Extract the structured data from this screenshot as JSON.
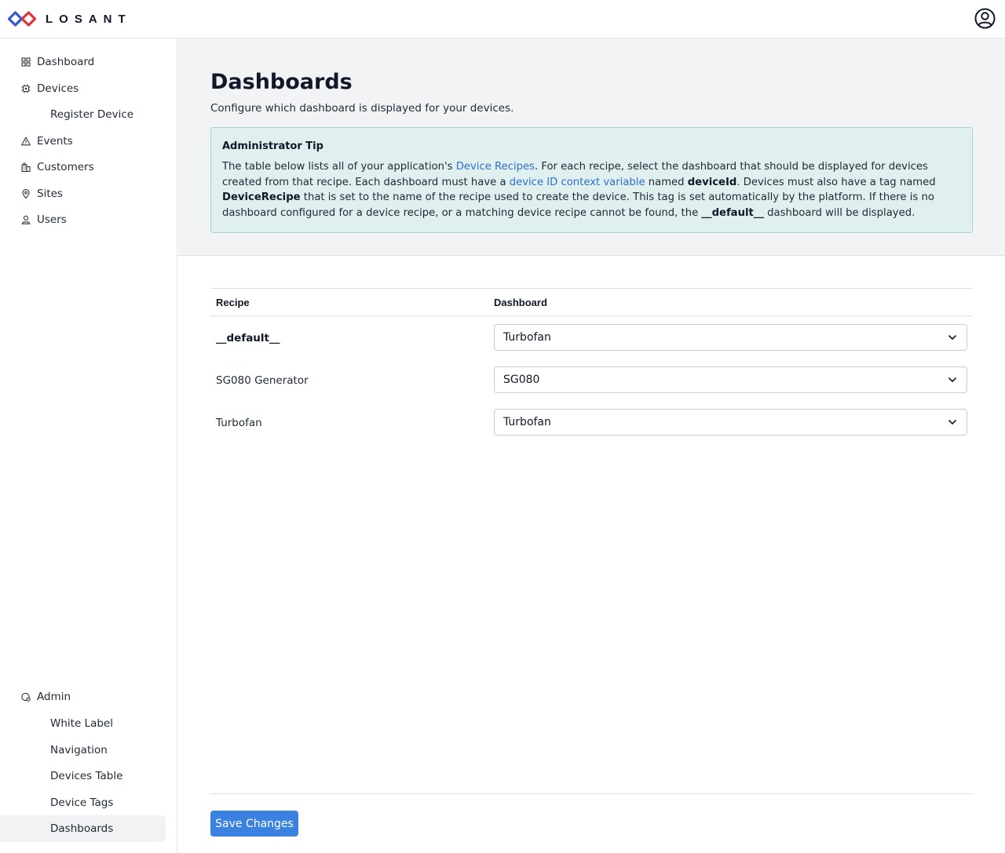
{
  "brand": {
    "name": "LOSANT",
    "colors": {
      "red": "#e0343a",
      "blue": "#3a56d4"
    }
  },
  "topbar": {
    "user_icon": "user-circle-icon"
  },
  "sidebar": {
    "items": [
      {
        "label": "Dashboard",
        "icon": "grid-icon"
      },
      {
        "label": "Devices",
        "icon": "chip-icon"
      },
      {
        "label": "Register Device"
      },
      {
        "label": "Events",
        "icon": "warning-triangle-icon"
      },
      {
        "label": "Customers",
        "icon": "building-icon"
      },
      {
        "label": "Sites",
        "icon": "map-pin-icon"
      },
      {
        "label": "Users",
        "icon": "user-icon"
      }
    ],
    "admin": {
      "label": "Admin",
      "icon": "admin-icon",
      "items": [
        {
          "label": "White Label"
        },
        {
          "label": "Navigation"
        },
        {
          "label": "Devices Table"
        },
        {
          "label": "Device Tags"
        },
        {
          "label": "Dashboards",
          "active": true
        }
      ]
    }
  },
  "page": {
    "title": "Dashboards",
    "subtitle": "Configure which dashboard is displayed for your devices."
  },
  "tip": {
    "title": "Administrator Tip",
    "t1": "The table below lists all of your application's ",
    "link1": "Device Recipes",
    "t2": ". For each recipe, select the dashboard that should be displayed for devices created from that recipe. Each dashboard must have a ",
    "link2": "device ID context variable",
    "t3": " named ",
    "b1": "deviceId",
    "t4": ". Devices must also have a tag named ",
    "b2": "DeviceRecipe",
    "t5": " that is set to the name of the recipe used to create the device. This tag is set automatically by the platform. If there is no dashboard configured for a device recipe, or a matching device recipe cannot be found, the ",
    "b3": "__default__",
    "t6": " dashboard will be displayed."
  },
  "table": {
    "headers": {
      "recipe": "Recipe",
      "dashboard": "Dashboard"
    },
    "rows": [
      {
        "recipe": "__default__",
        "dashboard": "Turbofan"
      },
      {
        "recipe": "SG080 Generator",
        "dashboard": "SG080"
      },
      {
        "recipe": "Turbofan",
        "dashboard": "Turbofan"
      }
    ]
  },
  "actions": {
    "save_label": "Save Changes"
  }
}
